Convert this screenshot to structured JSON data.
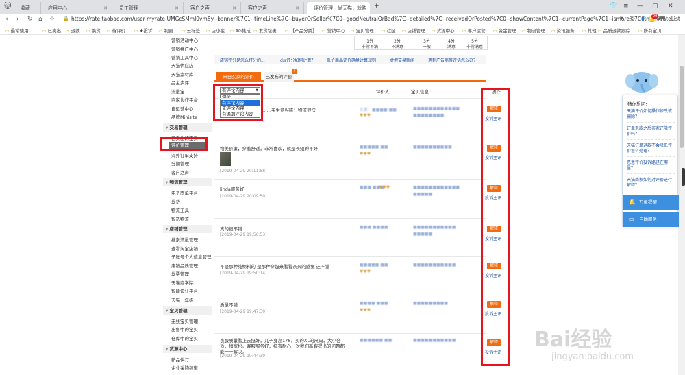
{
  "browser": {
    "tabs": [
      "收藏",
      "应用中心",
      "员工管理",
      "客户之声",
      "客户之声",
      "评价管理 - 尚天猫，就购"
    ],
    "url": "https://rate.taobao.com/user-myrate-UMGcSMmI0vm8y--banner%7C1--timeLine%7C--buyerOrSeller%7C0--goodNeutralOrBad%7C--detailed%7C--receivedOrPosted%7C0--showContent%7C1--currentPage%7C1--ismore%7C0.htm#rateList",
    "notification_count": "99",
    "bookmarks": [
      "最常使用",
      "已卖出",
      "退款",
      "换货",
      "待评价",
      "★投诉",
      "视窗",
      "云标签",
      "店小蜜",
      "AG集成",
      "发货包裹",
      "【产品分类】",
      "营销中心",
      "宝贝管理",
      "社区",
      "店铺管理",
      "货源中心",
      "客户运营",
      "资金管理",
      "物流管理",
      "资讯服务",
      "其他",
      "品质退款跟踪",
      "所有宝贝"
    ]
  },
  "sidebar": {
    "items_top": [
      "营销活动中心",
      "营销推广中心",
      "营销工具中心",
      "天猫供应店",
      "天猫素材库",
      "品主步评",
      "流量宝",
      "商家协作平台",
      "自运营中心",
      "品牌Minisite"
    ],
    "section_trade": "交易管理",
    "trade_items": [
      "已卖出的宝贝",
      "评价管理",
      "海外订单支持",
      "分期管理",
      "客户之声"
    ],
    "active_item": "评价管理",
    "section_logistics": "物流管理",
    "logistics_items": [
      "电子面单平台",
      "发货",
      "物流工具",
      "智选物流"
    ],
    "section_store": "店铺管理",
    "store_items": [
      "搜索流量管理",
      "查看淘宝店铺",
      "子账号个人信息管理",
      "店铺品质管理",
      "发票管理",
      "天猫商学院",
      "智能设计平台",
      "天猫一年级"
    ],
    "section_goods": "宝贝管理",
    "goods_items": [
      "无线宝贝管理",
      "出售中的宝贝",
      "仓库中的宝贝"
    ],
    "section_source": "货源中心",
    "source_items": [
      "新品供订",
      "企业采购频道"
    ]
  },
  "stats": {
    "columns": [
      {
        "days": "1分",
        "label": "非常不满"
      },
      {
        "days": "2分",
        "label": "不满意"
      },
      {
        "days": "3分",
        "label": "一般"
      },
      {
        "days": "4分",
        "label": "满意"
      },
      {
        "days": "5分",
        "label": "非常满意"
      }
    ]
  },
  "help_links": [
    "店铺评分是怎么打分的...",
    "dsr评分如何计算？",
    "低价商品评价确量计算规则",
    "虚假交易新闻",
    "遇到广告商等评语怎么办？"
  ],
  "review_tabs": {
    "received": "来自买家的评价",
    "given": "已发布的评价"
  },
  "columns": {
    "reviewer": "评价人",
    "item_info": "宝贝信息",
    "action": "操作"
  },
  "filter": {
    "selected": "有评论内容",
    "options": [
      "评论",
      "有评论内容",
      "无评论内容",
      "有追加评论内容"
    ],
    "highlighted_index": 1
  },
  "rows": [
    {
      "comment": "……买生意兴隆！物流很快",
      "date": ""
    },
    {
      "comment": "物美价廉，穿着舒适，非常喜欢，就是长短的不好",
      "date": "[2019-04-29 20:11:58]"
    },
    {
      "comment": "linda服务好",
      "date": "[2019-04-29 20:09:50]"
    },
    {
      "comment": "真的很不错",
      "date": "[2019-04-29 19:56:53]"
    },
    {
      "comment": "不是那种纯棉料的 是那种穿起来看看亲亲的感觉 还不错",
      "date": "[2019-04-29 19:50:14]"
    },
    {
      "comment": "质量不错",
      "date": "[2019-04-29 19:47:30]"
    },
    {
      "comment": "衣服质量看上去挺好，儿子身高178，买的XL的尺码，大小合适，稍宽松。客服服务好，挺有耐心，对我们新客提出的问题都能一一解决。",
      "date": "[2019-04-29 19:44:39]"
    }
  ],
  "actions": {
    "explain": "解释",
    "complain": "投诉主评"
  },
  "helper": {
    "title": "猜你想问：",
    "questions": [
      "天猫评价如何操作修改或删除？",
      "订单退款之后买家还能评价吗？",
      "天猫订单退款不会降低评价怎么处理？",
      "恶意评价投诉路径在哪里？",
      "天猫商家如何对评价进行解释？"
    ],
    "btn1": "万象提醒",
    "btn2": "自助服务"
  },
  "watermark": {
    "main": "Bai经验",
    "sub": "jingyan.baidu.com"
  }
}
